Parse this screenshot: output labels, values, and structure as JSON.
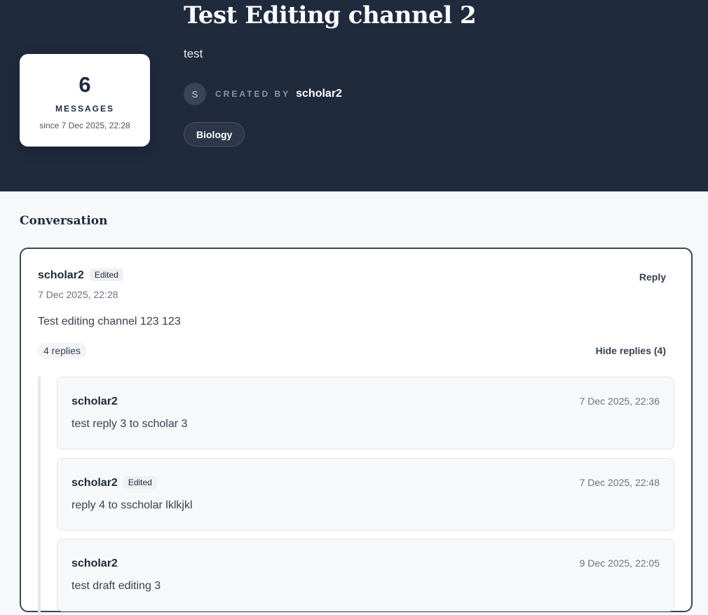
{
  "channel": {
    "title": "Test Editing channel 2",
    "description": "test",
    "created_by_label": "CREATED BY",
    "creator": "scholar2",
    "creator_initial": "S",
    "tag": "Biology"
  },
  "stats": {
    "count": "6",
    "label": "MESSAGES",
    "since": "since 7 Dec 2025, 22:28"
  },
  "conversation": {
    "heading": "Conversation",
    "message": {
      "author": "scholar2",
      "edited_badge": "Edited",
      "timestamp": "7 Dec 2025, 22:28",
      "reply_label": "Reply",
      "body": "Test editing channel 123 123",
      "replies_count": "4 replies",
      "hide_replies_label": "Hide replies (4)"
    },
    "replies": [
      {
        "author": "scholar2",
        "edited_badge": "",
        "timestamp": "7 Dec 2025, 22:36",
        "body": "test reply 3 to scholar 3"
      },
      {
        "author": "scholar2",
        "edited_badge": "Edited",
        "timestamp": "7 Dec 2025, 22:48",
        "body": "reply 4 to sscholar lklkjkl"
      },
      {
        "author": "scholar2",
        "edited_badge": "",
        "timestamp": "9 Dec 2025, 22:05",
        "body": "test draft editing 3"
      }
    ]
  }
}
